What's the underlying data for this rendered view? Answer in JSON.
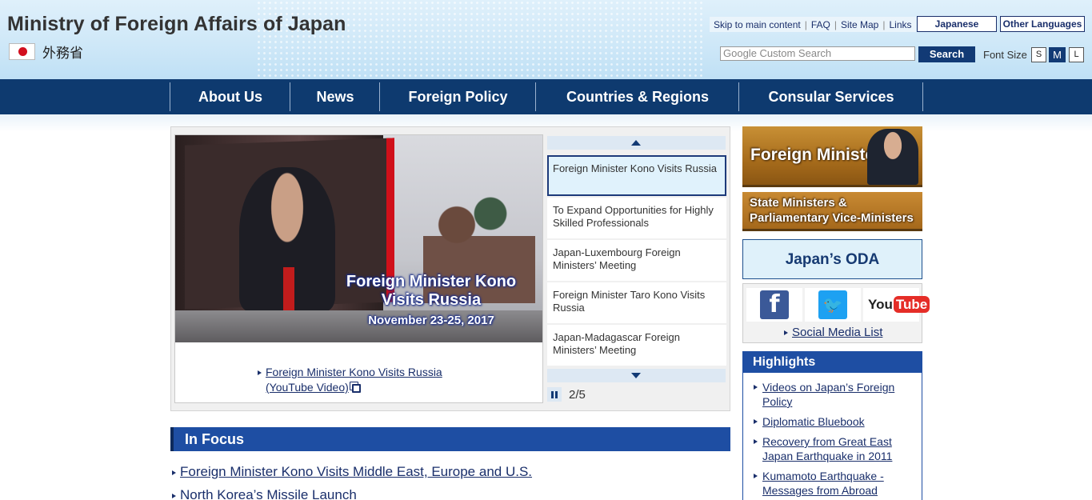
{
  "header": {
    "site_title": "Ministry of Foreign Affairs of Japan",
    "site_title_jp": "外務省",
    "util_links": [
      "Skip to main content",
      "FAQ",
      "Site Map",
      "Links"
    ],
    "lang_japanese": "Japanese",
    "lang_other": "Other Languages",
    "search_placeholder": "Google Custom Search",
    "search_button": "Search",
    "font_size_label": "Font Size",
    "font_sizes": [
      "S",
      "M",
      "L"
    ],
    "font_size_selected": "M"
  },
  "nav": {
    "items": [
      "About Us",
      "News",
      "Foreign Policy",
      "Countries & Regions",
      "Consular Services"
    ]
  },
  "carousel": {
    "slide_caption_line1": "Foreign Minister Kono",
    "slide_caption_line2": "Visits Russia",
    "slide_caption_date": "November 23-25, 2017",
    "slide_link_line1": "Foreign Minister Kono Visits Russia",
    "slide_link_line2": "(YouTube Video)",
    "thumbnails": [
      "Foreign Minister Kono Visits Russia",
      "To Expand Opportunities for Highly Skilled Professionals",
      "Japan-Luxembourg Foreign Ministers’ Meeting",
      "Foreign Minister Taro Kono Visits Russia",
      "Japan-Madagascar Foreign Ministers’ Meeting"
    ],
    "active_index": 0,
    "counter": "2/5"
  },
  "in_focus": {
    "title": "In Focus",
    "links": [
      "Foreign Minister Kono Visits Middle East, Europe and U.S.",
      "North Korea’s Missile Launch"
    ]
  },
  "sidebar": {
    "foreign_minister": "Foreign Minister",
    "state_ministers_line1": "State Ministers &",
    "state_ministers_line2": "Parliamentary Vice-Ministers",
    "oda": "Japan’s ODA",
    "social_icons": [
      "facebook-icon",
      "twitter-icon",
      "youtube-icon"
    ],
    "youtube_prefix": "You",
    "youtube_suffix": "Tube",
    "social_list": "Social Media List",
    "highlights_title": "Highlights",
    "highlights": [
      "Videos on Japan’s Foreign Policy",
      "Diplomatic Bluebook",
      "Recovery from Great East Japan Earthquake in 2011",
      "Kumamoto Earthquake - Messages from Abroad"
    ]
  },
  "colors": {
    "nav_bg": "#0e3a6f",
    "section_bar": "#1e4ea3",
    "link": "#1a2f6b",
    "accent_gold": "#b57a25"
  }
}
